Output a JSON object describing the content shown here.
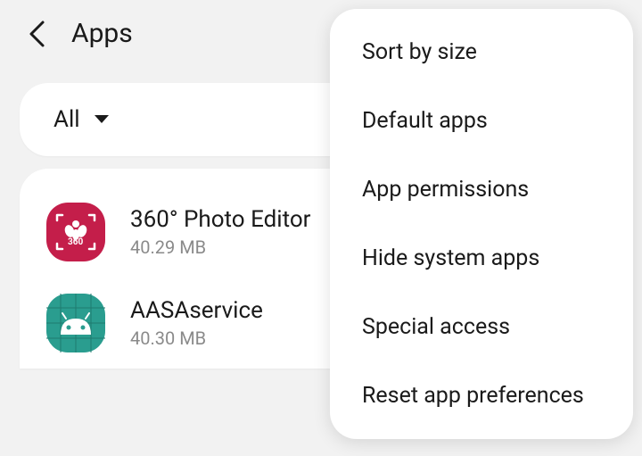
{
  "header": {
    "title": "Apps"
  },
  "filter": {
    "label": "All"
  },
  "apps": [
    {
      "name": "360° Photo Editor",
      "size": "40.29 MB",
      "icon_color": "#c41e4a",
      "icon_type": "photo360"
    },
    {
      "name": "AASAservice",
      "size": "40.30 MB",
      "icon_color": "#2a9d8f",
      "icon_type": "android"
    }
  ],
  "menu": {
    "items": [
      "Sort by size",
      "Default apps",
      "App permissions",
      "Hide system apps",
      "Special access",
      "Reset app preferences"
    ]
  }
}
